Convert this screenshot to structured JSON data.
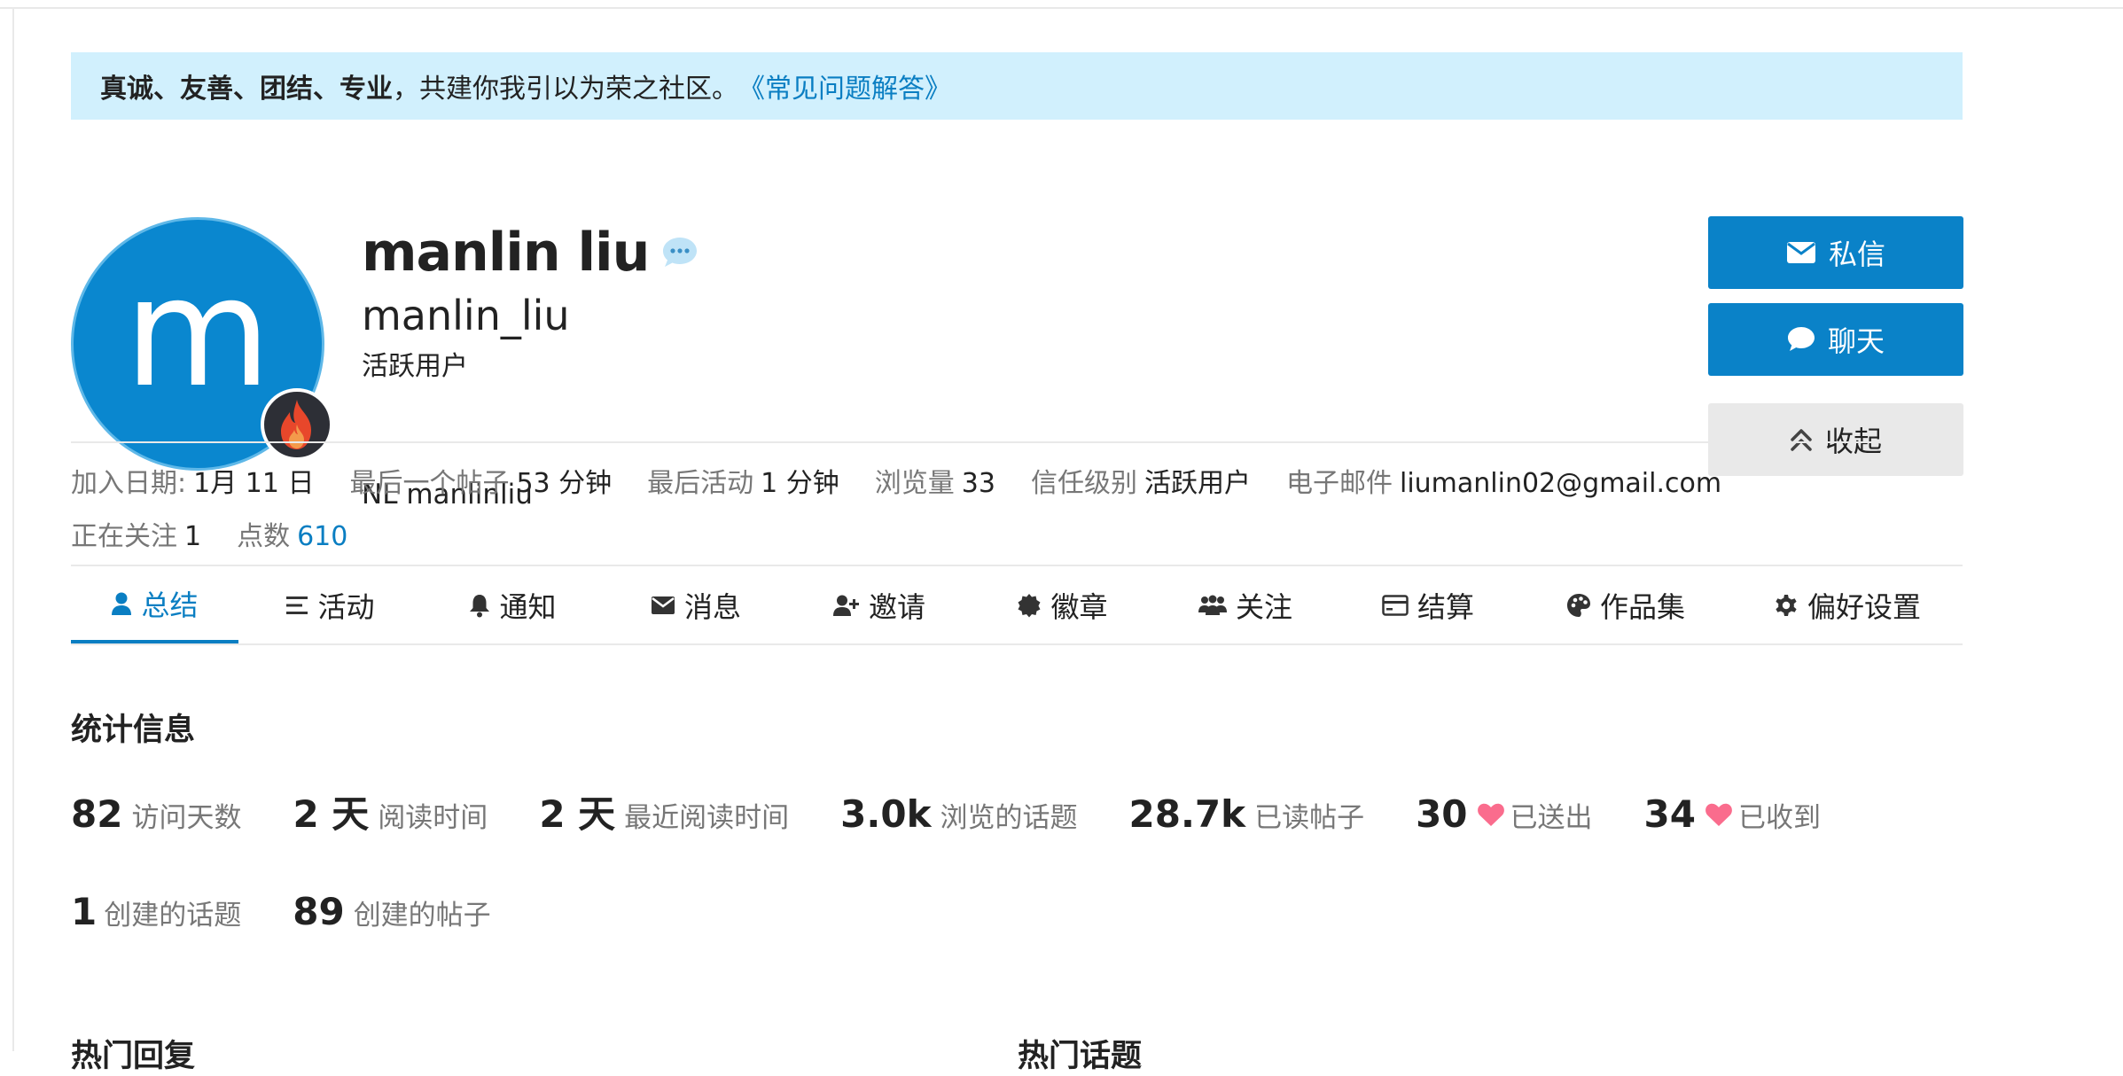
{
  "banner": {
    "bold_text": "真诚、友善、团结、专业",
    "text": "，共建你我引以为荣之社区。",
    "link": "《常见问题解答》"
  },
  "profile": {
    "avatar_letter": "m",
    "full_name": "manlin liu",
    "username": "manlin_liu",
    "title": "活跃用户",
    "bio": "NL manlinliu"
  },
  "buttons": {
    "message": "私信",
    "chat": "聊天",
    "collapse": "收起"
  },
  "meta": {
    "row1": [
      {
        "label": "加入日期:",
        "value": "1月 11 日"
      },
      {
        "label": "最后一个帖子",
        "value": "53 分钟"
      },
      {
        "label": "最后活动",
        "value": "1 分钟"
      },
      {
        "label": "浏览量",
        "value": "33"
      },
      {
        "label": "信任级别",
        "value": "活跃用户"
      },
      {
        "label": "电子邮件",
        "value": "liumanlin02@gmail.com"
      }
    ],
    "row2": [
      {
        "label": "正在关注",
        "value": "1"
      },
      {
        "label": "点数",
        "value": "610"
      }
    ]
  },
  "nav": {
    "tabs": [
      {
        "label": "总结",
        "icon": "user-icon"
      },
      {
        "label": "活动",
        "icon": "list-icon"
      },
      {
        "label": "通知",
        "icon": "bell-icon"
      },
      {
        "label": "消息",
        "icon": "envelope-icon"
      },
      {
        "label": "邀请",
        "icon": "user-plus-icon"
      },
      {
        "label": "徽章",
        "icon": "badge-icon"
      },
      {
        "label": "关注",
        "icon": "users-icon"
      },
      {
        "label": "结算",
        "icon": "credit-card-icon"
      },
      {
        "label": "作品集",
        "icon": "palette-icon"
      },
      {
        "label": "偏好设置",
        "icon": "gear-icon"
      }
    ]
  },
  "stats": {
    "title": "统计信息",
    "row1": [
      {
        "num": "82",
        "label": "访问天数"
      },
      {
        "num": "2 天",
        "label": "阅读时间"
      },
      {
        "num": "2 天",
        "label": "最近阅读时间"
      },
      {
        "num": "3.0k",
        "label": "浏览的话题"
      },
      {
        "num": "28.7k",
        "label": "已读帖子"
      },
      {
        "num": "30",
        "label": "已送出"
      },
      {
        "num": "34",
        "label": "已收到"
      }
    ],
    "row2": [
      {
        "num": "1",
        "label": "创建的话题"
      },
      {
        "num": "89",
        "label": "创建的帖子"
      }
    ]
  },
  "sections": {
    "top_replies": "热门回复",
    "top_topics": "热门话题"
  },
  "colors": {
    "accent": "#0a82c8",
    "banner_bg": "#d1f0fd",
    "heart": "#fa6c8d"
  }
}
